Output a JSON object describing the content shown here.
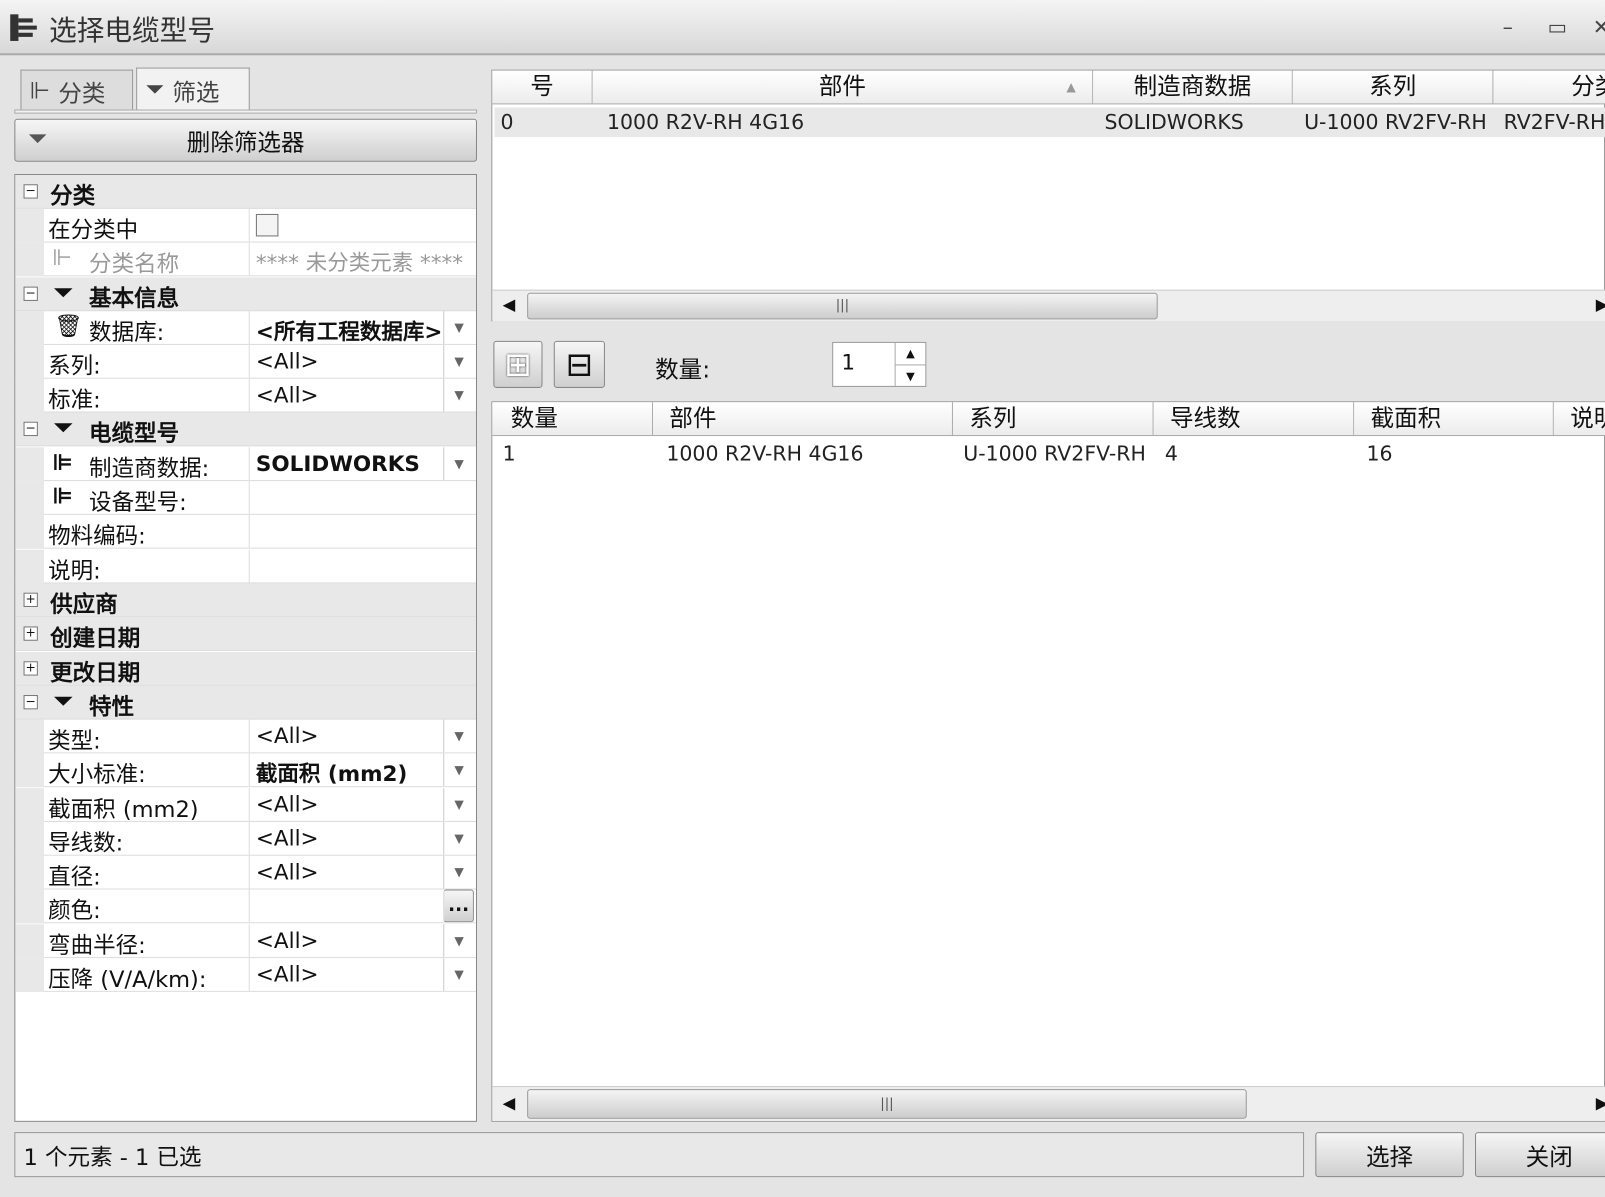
{
  "window": {
    "title": "选择电缆型号",
    "min": "–",
    "max": "▭",
    "close": "✕"
  },
  "tabs": [
    {
      "label": "分类"
    },
    {
      "label": "筛选"
    }
  ],
  "remove_filter_label": "删除筛选器",
  "filter": {
    "cat_classification": "分类",
    "in_class_label": "在分类中",
    "in_class_checked": false,
    "class_name_label": "分类名称",
    "class_name_value": "**** 未分类元素 ****",
    "cat_basic": "基本信息",
    "database_label": "数据库:",
    "database_value": "<所有工程数据库>",
    "series_label": "系列:",
    "series_value": "<All>",
    "standard_label": "标准:",
    "standard_value": "<All>",
    "cat_cable": "电缆型号",
    "manufacturer_label": "制造商数据:",
    "manufacturer_value": "SOLIDWORKS",
    "device_label": "设备型号:",
    "material_label": "物料编码:",
    "desc_label": "说明:",
    "cat_supplier": "供应商",
    "cat_created": "创建日期",
    "cat_modified": "更改日期",
    "cat_props": "特性",
    "type_label": "类型:",
    "type_value": "<All>",
    "size_label": "大小标准:",
    "size_value": "截面积 (mm2)",
    "section_label": "截面积 (mm2)",
    "section_value": "<All>",
    "wires_label": "导线数:",
    "wires_value": "<All>",
    "diameter_label": "直径:",
    "diameter_value": "<All>",
    "color_label": "颜色:",
    "color_btn": "...",
    "bend_label": "弯曲半径:",
    "bend_value": "<All>",
    "drop_label": "压降 (V/A/km):",
    "drop_value": "<All>"
  },
  "top_table": {
    "headers": [
      "号",
      "部件",
      "制造商数据",
      "系列",
      "分类"
    ],
    "sort_indicator": "▲",
    "rows": [
      [
        "0",
        "1000 R2V-RH 4G16",
        "SOLIDWORKS",
        "U-1000 RV2FV-RH",
        "RV2FV-RH"
      ]
    ]
  },
  "qty_label": "数量:",
  "qty_value": "1",
  "bottom_table": {
    "headers": [
      "数量",
      "部件",
      "系列",
      "导线数",
      "截面积",
      "说明"
    ],
    "rows": [
      [
        "1",
        "1000 R2V-RH 4G16",
        "U-1000 RV2FV-RH",
        "4",
        "16",
        ""
      ]
    ]
  },
  "status": "1 个元素 - 1 已选",
  "select_label": "选择",
  "close_label": "关闭"
}
